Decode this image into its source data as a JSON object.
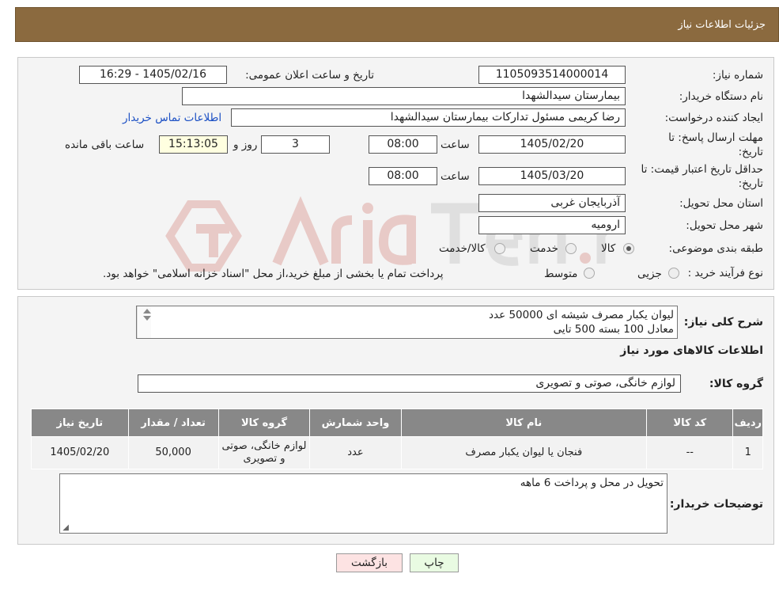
{
  "header": {
    "title": "جزئیات اطلاعات نیاز"
  },
  "form": {
    "need_number_label": "شماره نیاز:",
    "need_number": "1105093514000014",
    "announce_label": "تاریخ و ساعت اعلان عمومی:",
    "announce_value": "1405/02/16 - 16:29",
    "buyer_org_label": "نام دستگاه خریدار:",
    "buyer_org": "بیمارستان سیدالشهدا",
    "requester_label": "ایجاد کننده درخواست:",
    "requester": "رضا کریمی مسئول تداركات بیمارستان سیدالشهدا",
    "contact_link": "اطلاعات تماس خریدار",
    "deadline_label_1": "مهلت ارسال پاسخ: تا",
    "deadline_label_2": "تاریخ:",
    "deadline_date": "1405/02/20",
    "time_label": "ساعت",
    "deadline_time": "08:00",
    "days_value": "3",
    "days_label": "روز و",
    "remaining_time": "15:13:05",
    "remaining_label": "ساعت باقی مانده",
    "validity_label_1": "حداقل تاریخ اعتبار قیمت: تا",
    "validity_label_2": "تاریخ:",
    "validity_date": "1405/03/20",
    "validity_time": "08:00",
    "province_label": "استان محل تحویل:",
    "province": "آذربایجان غربی",
    "city_label": "شهر محل تحویل:",
    "city": "ارومیه",
    "category_label": "طبقه بندی موضوعی:",
    "category_options": [
      "کالا",
      "خدمت",
      "کالا/خدمت"
    ],
    "category_selected": "کالا",
    "process_label": "نوع فرآیند خرید :",
    "process_options": [
      "جزیی",
      "متوسط"
    ],
    "process_note": "پرداخت تمام یا بخشی از مبلغ خرید،از محل \"اسناد خزانه اسلامی\" خواهد بود."
  },
  "details": {
    "summary_label": "شرح کلی نیاز:",
    "summary_text": "لیوان یکبار مصرف شیشه ای 50000 عدد\nمعادل 100 بسته 500 تایی",
    "goods_info_title": "اطلاعات کالاهای مورد نیاز",
    "goods_group_label": "گروه کالا:",
    "goods_group": "لوازم خانگی، صوتی و تصویری",
    "table": {
      "headers": [
        "ردیف",
        "کد کالا",
        "نام کالا",
        "واحد شمارش",
        "گروه کالا",
        "تعداد / مقدار",
        "تاریخ نیاز"
      ],
      "rows": [
        [
          "1",
          "--",
          "فنجان یا لیوان یکبار مصرف",
          "عدد",
          "لوازم خانگی، صوتی و تصویری",
          "50,000",
          "1405/02/20"
        ]
      ]
    },
    "buyer_notes_label": "توضیحات خریدار:",
    "buyer_notes": "تحویل در محل و پرداخت 6 ماهه"
  },
  "buttons": {
    "print": "چاپ",
    "back": "بازگشت"
  },
  "colors": {
    "header_bg": "#8b6a3f",
    "table_header_bg": "#888888",
    "back_btn_bg": "#fde3e3",
    "print_btn_bg": "#e9fbe2"
  }
}
